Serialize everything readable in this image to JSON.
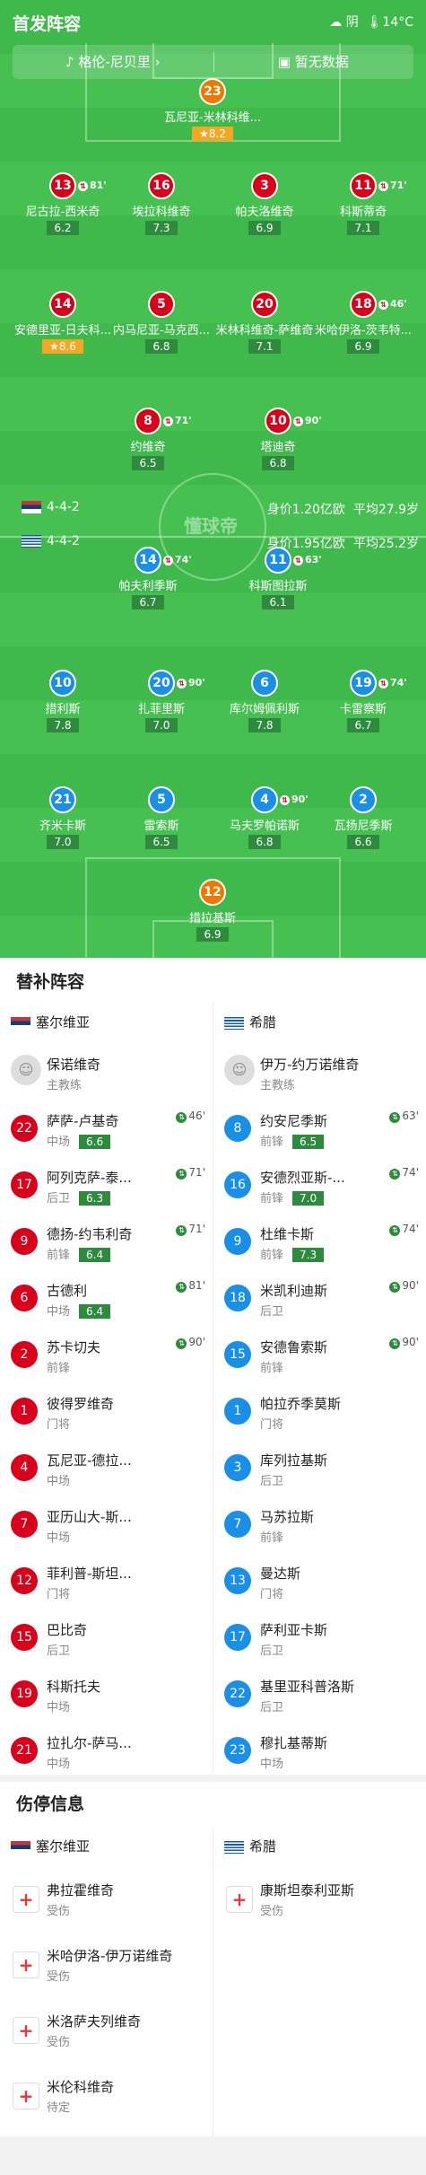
{
  "header": {
    "title": "首发阵容",
    "weather": "阴",
    "temp": "14°C"
  },
  "bar": {
    "referee": "格伦-尼贝里",
    "venue": "暂无数据"
  },
  "watermark": "懂球帝",
  "home": {
    "formation": "4-4-2",
    "value": "身价1.20亿欧",
    "age": "平均27.9岁"
  },
  "away": {
    "formation": "4-4-2",
    "value": "身价1.95亿欧",
    "age": "平均25.2岁"
  },
  "players": [
    {
      "no": "23",
      "name": "瓦尼亚-米林科维...",
      "rating": "8.2",
      "best": true,
      "color": "ora"
    },
    {
      "no": "13",
      "name": "尼古拉-西米奇",
      "rating": "6.2",
      "sub": "81'",
      "color": "red"
    },
    {
      "no": "16",
      "name": "埃拉科维奇",
      "rating": "7.3",
      "color": "red"
    },
    {
      "no": "3",
      "name": "帕夫洛维奇",
      "rating": "6.9",
      "color": "red"
    },
    {
      "no": "11",
      "name": "科斯蒂奇",
      "rating": "7.1",
      "sub": "71'",
      "color": "red"
    },
    {
      "no": "14",
      "name": "安德里亚-日夫科...",
      "rating": "8.6",
      "best": true,
      "color": "red"
    },
    {
      "no": "5",
      "name": "内马尼亚-马克西...",
      "rating": "6.8",
      "color": "red"
    },
    {
      "no": "20",
      "name": "米林科维奇-萨维奇",
      "rating": "7.1",
      "color": "red"
    },
    {
      "no": "18",
      "name": "米哈伊洛-茨韦特...",
      "rating": "6.9",
      "sub": "46'",
      "color": "red"
    },
    {
      "no": "8",
      "name": "约维奇",
      "rating": "6.5",
      "sub": "71'",
      "color": "red"
    },
    {
      "no": "10",
      "name": "塔迪奇",
      "rating": "6.8",
      "sub": "90'",
      "color": "red"
    },
    {
      "no": "14",
      "name": "帕夫利季斯",
      "rating": "6.7",
      "sub": "74'",
      "color": "blu"
    },
    {
      "no": "11",
      "name": "科斯图拉斯",
      "rating": "6.1",
      "sub": "63'",
      "color": "blu"
    },
    {
      "no": "10",
      "name": "措利斯",
      "rating": "7.8",
      "color": "blu"
    },
    {
      "no": "20",
      "name": "扎菲里斯",
      "rating": "7.0",
      "sub": "90'",
      "color": "blu"
    },
    {
      "no": "6",
      "name": "库尔姆佩利斯",
      "rating": "7.8",
      "color": "blu"
    },
    {
      "no": "19",
      "name": "卡雷察斯",
      "rating": "6.7",
      "sub": "74'",
      "color": "blu"
    },
    {
      "no": "21",
      "name": "齐米卡斯",
      "rating": "7.0",
      "color": "blu"
    },
    {
      "no": "5",
      "name": "雷索斯",
      "rating": "6.5",
      "color": "blu"
    },
    {
      "no": "4",
      "name": "马夫罗帕诺斯",
      "rating": "6.8",
      "sub": "90'",
      "color": "blu"
    },
    {
      "no": "2",
      "name": "瓦扬尼季斯",
      "rating": "6.6",
      "color": "blu"
    },
    {
      "no": "12",
      "name": "措拉基斯",
      "rating": "6.9",
      "color": "ora"
    }
  ],
  "subs": {
    "title": "替补阵容",
    "home_team": "塞尔维亚",
    "away_team": "希腊",
    "home": [
      {
        "name": "保诺维奇",
        "pos": "主教练",
        "coach": true
      },
      {
        "no": "22",
        "name": "萨萨-卢基奇",
        "pos": "中场",
        "score": "6.6",
        "ev": "46'"
      },
      {
        "no": "17",
        "name": "阿列克萨-泰...",
        "pos": "后卫",
        "score": "6.3",
        "ev": "71'"
      },
      {
        "no": "9",
        "name": "德扬-约韦利奇",
        "pos": "前锋",
        "score": "6.4",
        "ev": "71'"
      },
      {
        "no": "6",
        "name": "古德利",
        "pos": "中场",
        "score": "6.4",
        "ev": "81'"
      },
      {
        "no": "2",
        "name": "苏卡切夫",
        "pos": "前锋",
        "ev": "90'"
      },
      {
        "no": "1",
        "name": "彼得罗维奇",
        "pos": "门将"
      },
      {
        "no": "4",
        "name": "瓦尼亚-德拉...",
        "pos": "中场"
      },
      {
        "no": "7",
        "name": "亚历山大-斯...",
        "pos": "中场"
      },
      {
        "no": "12",
        "name": "菲利普-斯坦...",
        "pos": "门将"
      },
      {
        "no": "15",
        "name": "巴比奇",
        "pos": "后卫"
      },
      {
        "no": "19",
        "name": "科斯托夫",
        "pos": "中场"
      },
      {
        "no": "21",
        "name": "拉扎尔-萨马...",
        "pos": "中场"
      }
    ],
    "away": [
      {
        "name": "伊万-约万诺维奇",
        "pos": "主教练",
        "coach": true
      },
      {
        "no": "8",
        "name": "约安尼季斯",
        "pos": "前锋",
        "score": "6.5",
        "ev": "63'"
      },
      {
        "no": "16",
        "name": "安德烈亚斯-...",
        "pos": "前锋",
        "score": "7.0",
        "ev": "74'"
      },
      {
        "no": "9",
        "name": "杜维卡斯",
        "pos": "前锋",
        "score": "7.3",
        "ev": "74'"
      },
      {
        "no": "18",
        "name": "米凯利迪斯",
        "pos": "后卫",
        "ev": "90'"
      },
      {
        "no": "15",
        "name": "安德鲁索斯",
        "pos": "前锋",
        "ev": "90'"
      },
      {
        "no": "1",
        "name": "帕拉乔季莫斯",
        "pos": "门将"
      },
      {
        "no": "3",
        "name": "库列拉基斯",
        "pos": "后卫"
      },
      {
        "no": "7",
        "name": "马苏拉斯",
        "pos": "前锋"
      },
      {
        "no": "13",
        "name": "曼达斯",
        "pos": "门将"
      },
      {
        "no": "17",
        "name": "萨利亚卡斯",
        "pos": "后卫"
      },
      {
        "no": "22",
        "name": "基里亚科普洛斯",
        "pos": "后卫"
      },
      {
        "no": "23",
        "name": "穆扎基蒂斯",
        "pos": "中场"
      }
    ]
  },
  "injury": {
    "title": "伤停信息",
    "home_team": "塞尔维亚",
    "away_team": "希腊",
    "home": [
      {
        "name": "弗拉霍维奇",
        "st": "受伤"
      },
      {
        "name": "米哈伊洛-伊万诺维奇",
        "st": "受伤"
      },
      {
        "name": "米洛萨夫列维奇",
        "st": "受伤"
      },
      {
        "name": "米伦科维奇",
        "st": "待定"
      }
    ],
    "away": [
      {
        "name": "康斯坦泰利亚斯",
        "st": "受伤"
      }
    ]
  }
}
